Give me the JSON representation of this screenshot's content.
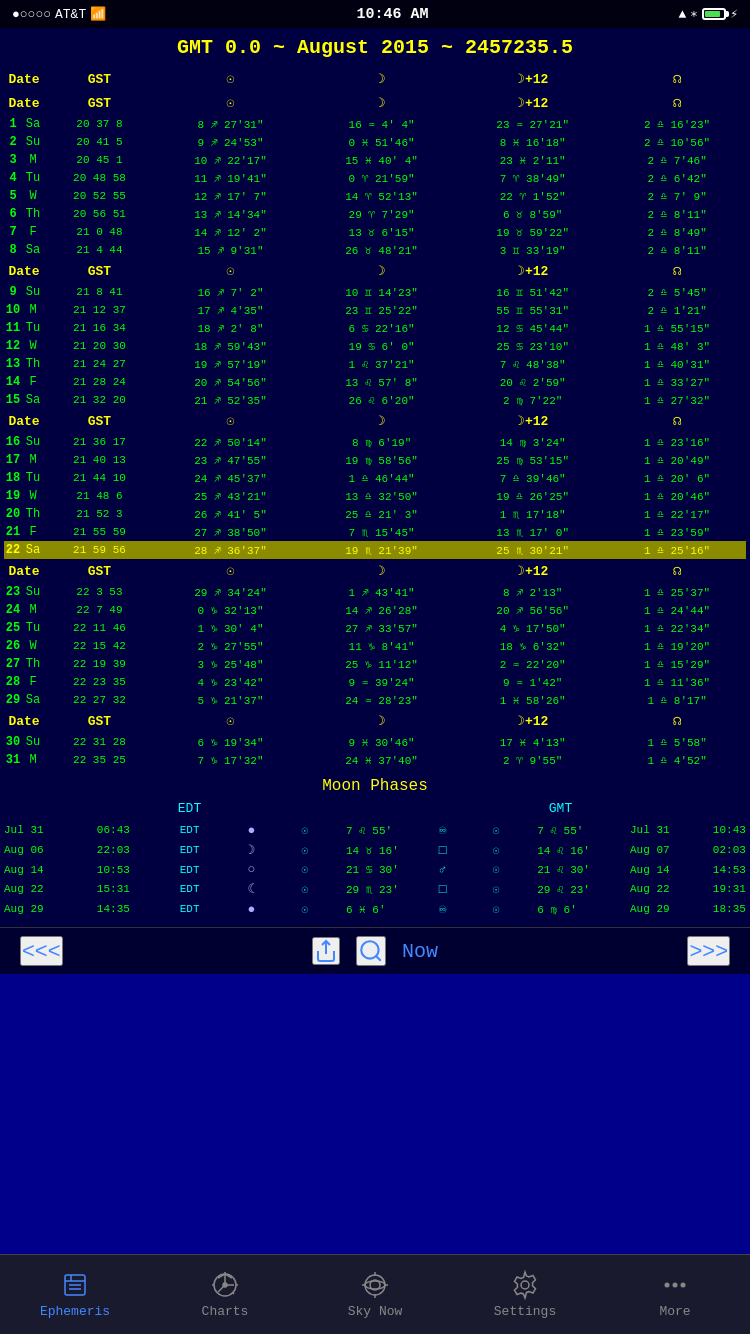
{
  "status": {
    "carrier": "AT&T",
    "time": "10:46 AM",
    "signal_dots": "●○○○○",
    "wifi": "WiFi",
    "location": "▲",
    "bluetooth": "B",
    "battery_percent": 85
  },
  "header": {
    "title": "GMT 0.0 ~ August 2015 ~ 2457235.5"
  },
  "columns": {
    "date": "Date",
    "gst": "GST",
    "sun": "☉",
    "moon": "☽",
    "moon12": "☽+12",
    "node": "Ω"
  },
  "rows": [
    {
      "num": "1",
      "day": "Sa",
      "gst": "20 37  8",
      "sun": "8 ♐ 27'31\"",
      "moon": "16 ♒  4'  4\"",
      "moon12": "23 ♒ 27'21\"",
      "node": "2 ♎ 16'23\""
    },
    {
      "num": "2",
      "day": "Su",
      "gst": "20 41  5",
      "sun": "9 ♐ 24'53\"",
      "moon": "0 ♓ 51'46\"",
      "moon12": "8 ♓ 16'18\"",
      "node": "2 ♎ 10'56\""
    },
    {
      "num": "3",
      "day": "M",
      "gst": "20 45  1",
      "sun": "10 ♐ 22'17\"",
      "moon": "15 ♓ 40'  4\"",
      "moon12": "23 ♓  2'11\"",
      "node": "2 ♎  7'46\""
    },
    {
      "num": "4",
      "day": "Tu",
      "gst": "20 48 58",
      "sun": "11 ♐ 19'41\"",
      "moon": "0 ♈ 21'59\"",
      "moon12": "7 ♈ 38'49\"",
      "node": "2 ♎  6'42\""
    },
    {
      "num": "5",
      "day": "W",
      "gst": "20 52 55",
      "sun": "12 ♐ 17'  7\"",
      "moon": "14 ♈ 52'13\"",
      "moon12": "22 ♈  1'52\"",
      "node": "2 ♎  7'  9\""
    },
    {
      "num": "6",
      "day": "Th",
      "gst": "20 56 51",
      "sun": "13 ♐ 14'34\"",
      "moon": "29 ♈  7'29\"",
      "moon12": "6 ♉  8'59\"",
      "node": "2 ♎  8'11\""
    },
    {
      "num": "7",
      "day": "F",
      "gst": "21  0 48",
      "sun": "14 ♐ 12'  2\"",
      "moon": "13 ♉  6'15\"",
      "moon12": "19 ♉ 59'22\"",
      "node": "2 ♎  8'49\""
    },
    {
      "num": "8",
      "day": "Sa",
      "gst": "21  4 44",
      "sun": "15 ♐  9'31\"",
      "moon": "26 ♉ 48'21\"",
      "moon12": "3 ♊ 33'19\"",
      "node": "2 ♎  8'11\""
    },
    {
      "num": "9",
      "day": "Su",
      "gst": "21  8 41",
      "sun": "16 ♐  7'  2\"",
      "moon": "10 ♊ 14'23\"",
      "moon12": "16 ♊ 51'42\"",
      "node": "2 ♎  5'45\""
    },
    {
      "num": "10",
      "day": "M",
      "gst": "21 12 37",
      "sun": "17 ♐  4'35\"",
      "moon": "23 ♊ 25'22\"",
      "moon12": "55 ♊ 55'31\"",
      "node": "2 ♎  1'21\""
    },
    {
      "num": "11",
      "day": "Tu",
      "gst": "21 16 34",
      "sun": "18 ♐  2'  8\"",
      "moon": "6 ♋ 22'16\"",
      "moon12": "12 ♋ 45'44\"",
      "node": "1 ♎ 55'15\""
    },
    {
      "num": "12",
      "day": "W",
      "gst": "21 20 30",
      "sun": "18 ♐ 59'43\"",
      "moon": "19 ♋  6'  0\"",
      "moon12": "25 ♋ 23'10\"",
      "node": "1 ♎ 48'  3\""
    },
    {
      "num": "13",
      "day": "Th",
      "gst": "21 24 27",
      "sun": "19 ♐ 57'19\"",
      "moon": "1 ♌ 37'21\"",
      "moon12": "7 ♌ 48'38\"",
      "node": "1 ♎ 40'31\""
    },
    {
      "num": "14",
      "day": "F",
      "gst": "21 28 24",
      "sun": "20 ♐ 54'56\"",
      "moon": "13 ♌ 57'  8\"",
      "moon12": "20 ♌  2'59\"",
      "node": "1 ♎ 33'27\""
    },
    {
      "num": "15",
      "day": "Sa",
      "gst": "21 32 20",
      "sun": "21 ♐ 52'35\"",
      "moon": "26 ♌  6'20\"",
      "moon12": "2 ♍  7'22\"",
      "node": "1 ♎ 27'32\""
    },
    {
      "num": "16",
      "day": "Su",
      "gst": "21 36 17",
      "sun": "22 ♐ 50'14\"",
      "moon": "8 ♍  6'19\"",
      "moon12": "14 ♍  3'24\"",
      "node": "1 ♎ 23'16\""
    },
    {
      "num": "17",
      "day": "M",
      "gst": "21 40 13",
      "sun": "23 ♐ 47'55\"",
      "moon": "19 ♍ 58'56\"",
      "moon12": "25 ♍ 53'15\"",
      "node": "1 ♎ 20'49\""
    },
    {
      "num": "18",
      "day": "Tu",
      "gst": "21 44 10",
      "sun": "24 ♐ 45'37\"",
      "moon": "1 ♎ 46'44\"",
      "moon12": "7 ♎ 39'46\"",
      "node": "1 ♎ 20'  6\""
    },
    {
      "num": "19",
      "day": "W",
      "gst": "21 48  6",
      "sun": "25 ♐ 43'21\"",
      "moon": "13 ♎ 32'50\"",
      "moon12": "19 ♎ 26'25\"",
      "node": "1 ♎ 20'46\""
    },
    {
      "num": "20",
      "day": "Th",
      "gst": "21 52  3",
      "sun": "26 ♐ 41'  5\"",
      "moon": "25 ♎ 21'  3\"",
      "moon12": "1 ♏ 17'18\"",
      "node": "1 ♎ 22'17\""
    },
    {
      "num": "21",
      "day": "F",
      "gst": "21 55 59",
      "sun": "27 ♐ 38'50\"",
      "moon": "7 ♏ 15'45\"",
      "moon12": "13 ♏ 17'  0\"",
      "node": "1 ♎ 23'59\""
    },
    {
      "num": "22",
      "day": "Sa",
      "gst": "21 59 56",
      "sun": "28 ♐ 36'37\"",
      "moon": "19 ♏ 21'39\"",
      "moon12": "25 ♏ 30'21\"",
      "node": "1 ♎ 25'16\"",
      "highlight": true
    },
    {
      "num": "23",
      "day": "Su",
      "gst": "22  3 53",
      "sun": "29 ♐ 34'24\"",
      "moon": "1 ♐ 43'41\"",
      "moon12": "8 ♐  2'13\"",
      "node": "1 ♎ 25'37\""
    },
    {
      "num": "24",
      "day": "M",
      "gst": "22  7 49",
      "sun": "0 ♑ 32'13\"",
      "moon": "14 ♐ 26'28\"",
      "moon12": "20 ♐ 56'56\"",
      "node": "1 ♎ 24'44\""
    },
    {
      "num": "25",
      "day": "Tu",
      "gst": "22 11 46",
      "sun": "1 ♑ 30'  4\"",
      "moon": "27 ♐ 33'57\"",
      "moon12": "4 ♑ 17'50\"",
      "node": "1 ♎ 22'34\""
    },
    {
      "num": "26",
      "day": "W",
      "gst": "22 15 42",
      "sun": "2 ♑ 27'55\"",
      "moon": "11 ♑  8'41\"",
      "moon12": "18 ♑  6'32\"",
      "node": "1 ♎ 19'20\""
    },
    {
      "num": "27",
      "day": "Th",
      "gst": "22 19 39",
      "sun": "3 ♑ 25'48\"",
      "moon": "25 ♑ 11'12\"",
      "moon12": "2 ♒ 22'20\"",
      "node": "1 ♎ 15'29\""
    },
    {
      "num": "28",
      "day": "F",
      "gst": "22 23 35",
      "sun": "4 ♑ 23'42\"",
      "moon": "9 ♒ 39'24\"",
      "moon12": "9 ♒  1'42\"",
      "node": "1 ♎ 11'36\""
    },
    {
      "num": "29",
      "day": "Sa",
      "gst": "22 27 32",
      "sun": "5 ♑ 21'37\"",
      "moon": "24 ♒ 28'23\"",
      "moon12": "1 ♓ 58'26\"",
      "node": "1 ♎  8'17\""
    },
    {
      "num": "30",
      "day": "Su",
      "gst": "22 31 28",
      "sun": "6 ♑ 19'34\"",
      "moon": "9 ♓ 30'46\"",
      "moon12": "17 ♓  4'13\"",
      "node": "1 ♎  5'58\""
    },
    {
      "num": "31",
      "day": "M",
      "gst": "22 35 25",
      "sun": "7 ♑ 17'32\"",
      "moon": "24 ♓ 37'40\"",
      "moon12": "2 ♈  9'55\"",
      "node": "1 ♎  4'52\""
    }
  ],
  "moon_phases": {
    "title": "Moon Phases",
    "headers": {
      "left": "EDT",
      "right": "GMT"
    },
    "phases": [
      {
        "edt_date": "Jul 31",
        "edt_time": "06:43",
        "edt_zone": "EDT",
        "symbol": "●",
        "sun_symbol": "☉",
        "sun_pos": "7 ♌ 55'",
        "link": "♾",
        "gmt_sun_symbol": "☉",
        "gmt_sun_pos": "7 ♌ 55'",
        "gmt_date": "Jul 31",
        "gmt_time": "10:43"
      },
      {
        "edt_date": "Aug 06",
        "edt_time": "22:03",
        "edt_zone": "EDT",
        "symbol": "☽",
        "sun_symbol": "☉",
        "sun_pos": "14 ♉ 16'",
        "link": "□",
        "gmt_sun_symbol": "☉",
        "gmt_sun_pos": "14 ♌ 16'",
        "gmt_date": "Aug 07",
        "gmt_time": "02:03"
      },
      {
        "edt_date": "Aug 14",
        "edt_time": "10:53",
        "edt_zone": "EDT",
        "symbol": "○",
        "sun_symbol": "☉",
        "sun_pos": "21 ♋ 30'",
        "link": "♂",
        "gmt_sun_symbol": "☉",
        "gmt_sun_pos": "21 ♌ 30'",
        "gmt_date": "Aug 14",
        "gmt_time": "14:53"
      },
      {
        "edt_date": "Aug 22",
        "edt_time": "15:31",
        "edt_zone": "EDT",
        "symbol": "☾",
        "sun_symbol": "☉",
        "sun_pos": "29 ♏ 23'",
        "link": "□",
        "gmt_sun_symbol": "☉",
        "gmt_sun_pos": "29 ♌ 23'",
        "gmt_date": "Aug 22",
        "gmt_time": "19:31"
      },
      {
        "edt_date": "Aug 29",
        "edt_time": "14:35",
        "edt_zone": "EDT",
        "symbol": "●",
        "sun_symbol": "☉",
        "sun_pos": "6 ♓  6'",
        "link": "♾",
        "gmt_sun_symbol": "☉",
        "gmt_sun_pos": "6 ♍  6'",
        "gmt_date": "Aug 29",
        "gmt_time": "18:35"
      }
    ]
  },
  "toolbar": {
    "prev": "<<<",
    "next": ">>>",
    "now": "Now",
    "share_icon": "share",
    "search_icon": "search"
  },
  "tabs": [
    {
      "id": "ephemeris",
      "label": "Ephemeris",
      "active": true
    },
    {
      "id": "charts",
      "label": "Charts",
      "active": false
    },
    {
      "id": "sky-now",
      "label": "Sky Now",
      "active": false
    },
    {
      "id": "settings",
      "label": "Settings",
      "active": false
    },
    {
      "id": "more",
      "label": "More",
      "active": false
    }
  ]
}
